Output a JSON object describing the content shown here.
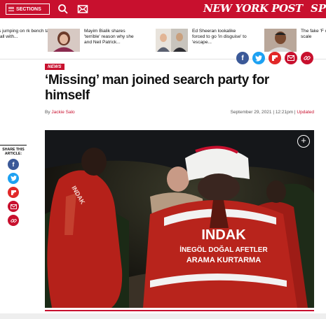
{
  "header": {
    "sections_label": "SECTIONS",
    "logo": "NEW YORK POST",
    "logo_partial": "SP",
    "brand_color": "#c8102e"
  },
  "ticker": [
    {
      "text": "s jumping on rk bench tal fall with..."
    },
    {
      "text": "Mayim Bialik shares 'terrible' reason why she and Neil Patrick..."
    },
    {
      "text": "Ed Sheeran lookalike forced to go 'in disguise' to 'escape..."
    },
    {
      "text": "The fake 'F outrage m the scale"
    }
  ],
  "article": {
    "section_badge": "NEWS",
    "headline": "‘Missing’ man joined search party for himself",
    "by_prefix": "By",
    "author": "Jackie Salo",
    "date": "September 29, 2021 | 12:21pm |",
    "updated": "Updated"
  },
  "share": {
    "label": "SHARE THIS ARTICLE:",
    "icons": [
      "facebook-icon",
      "twitter-icon",
      "flipboard-icon",
      "email-icon",
      "link-icon"
    ]
  },
  "hero": {
    "jacket_text_1": "INDAK",
    "jacket_text_2": "İNEGÖL DOĞAL AFETLER",
    "jacket_text_3": "ARAMA KURTARMA",
    "left_jacket": "INDAK"
  }
}
